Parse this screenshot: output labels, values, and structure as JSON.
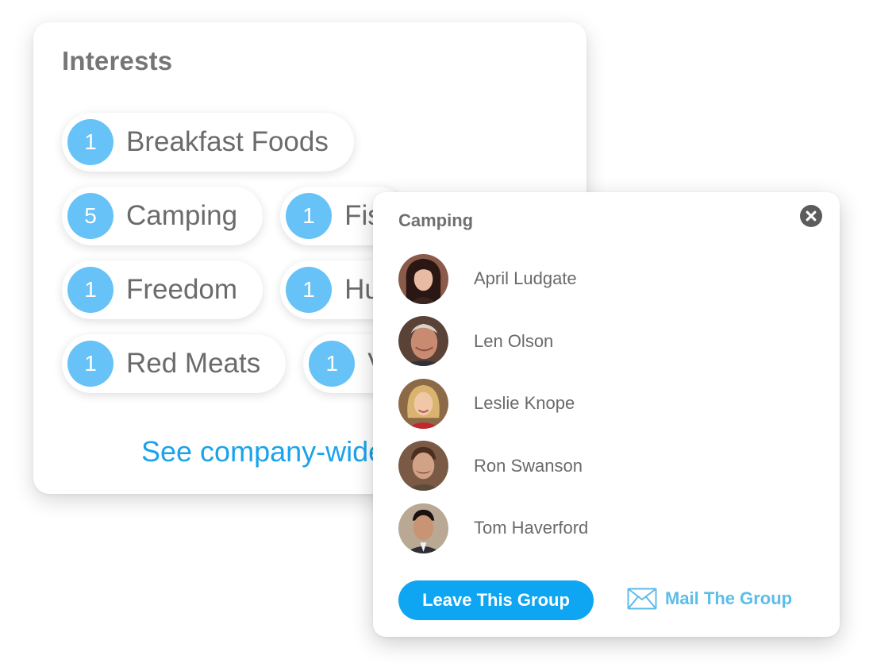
{
  "interests": {
    "title": "Interests",
    "rows": [
      [
        {
          "count": "1",
          "label": "Breakfast Foods"
        }
      ],
      [
        {
          "count": "5",
          "label": "Camping"
        },
        {
          "count": "1",
          "label": "Fis"
        }
      ],
      [
        {
          "count": "1",
          "label": "Freedom"
        },
        {
          "count": "1",
          "label": "Hu"
        }
      ],
      [
        {
          "count": "1",
          "label": "Red Meats"
        },
        {
          "count": "1",
          "label": "V"
        }
      ]
    ],
    "see_link": "See company-wide"
  },
  "popover": {
    "title": "Camping",
    "close_icon": "close-circle-icon",
    "members": [
      {
        "name": "April Ludgate"
      },
      {
        "name": "Len Olson"
      },
      {
        "name": "Leslie Knope"
      },
      {
        "name": "Ron Swanson"
      },
      {
        "name": "Tom Haverford"
      }
    ],
    "leave_button": "Leave This Group",
    "mail_icon": "envelope-icon",
    "mail_label": "Mail The Group"
  },
  "colors": {
    "chip_badge": "#66c2f7",
    "link": "#1aa3ea",
    "primary_button": "#0ea5f2",
    "mail_link": "#5bbde9"
  }
}
